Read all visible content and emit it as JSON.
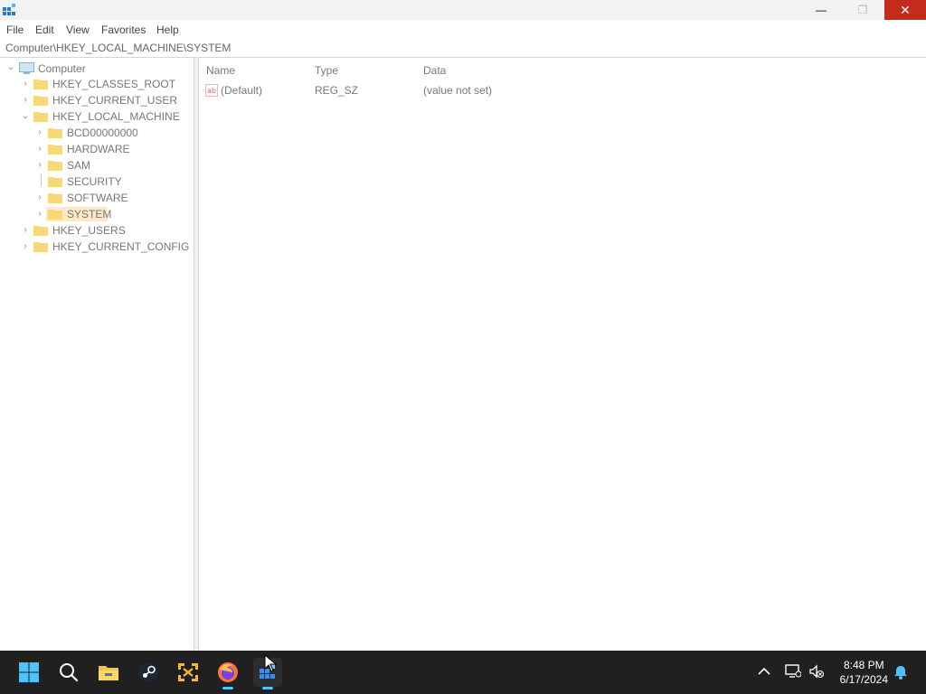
{
  "window": {
    "minimize_glyph": "—",
    "restore_glyph": "❐",
    "close_glyph": "✕"
  },
  "menu": {
    "items": [
      "File",
      "Edit",
      "View",
      "Favorites",
      "Help"
    ]
  },
  "address": {
    "path": "Computer\\HKEY_LOCAL_MACHINE\\SYSTEM"
  },
  "tree": {
    "root": "Computer",
    "items": [
      {
        "label": "HKEY_CLASSES_ROOT"
      },
      {
        "label": "HKEY_CURRENT_USER"
      },
      {
        "label": "HKEY_LOCAL_MACHINE"
      },
      {
        "label": "BCD00000000"
      },
      {
        "label": "HARDWARE"
      },
      {
        "label": "SAM"
      },
      {
        "label": "SECURITY"
      },
      {
        "label": "SOFTWARE"
      },
      {
        "label": "SYSTEM"
      },
      {
        "label": "HKEY_USERS"
      },
      {
        "label": "HKEY_CURRENT_CONFIG"
      }
    ]
  },
  "list": {
    "columns": [
      "Name",
      "Type",
      "Data"
    ],
    "rows": [
      {
        "name": "(Default)",
        "type": "REG_SZ",
        "data": "(value not set)"
      }
    ]
  },
  "taskbar": {
    "time": "8:48 PM",
    "date": "6/17/2024"
  },
  "colors": {
    "close_red": "#c42b1c",
    "selection": "#fbe9c7",
    "taskbar_bg": "#202020",
    "accent_blue": "#4cc2ff",
    "folder_yellow": "#f8d775"
  }
}
